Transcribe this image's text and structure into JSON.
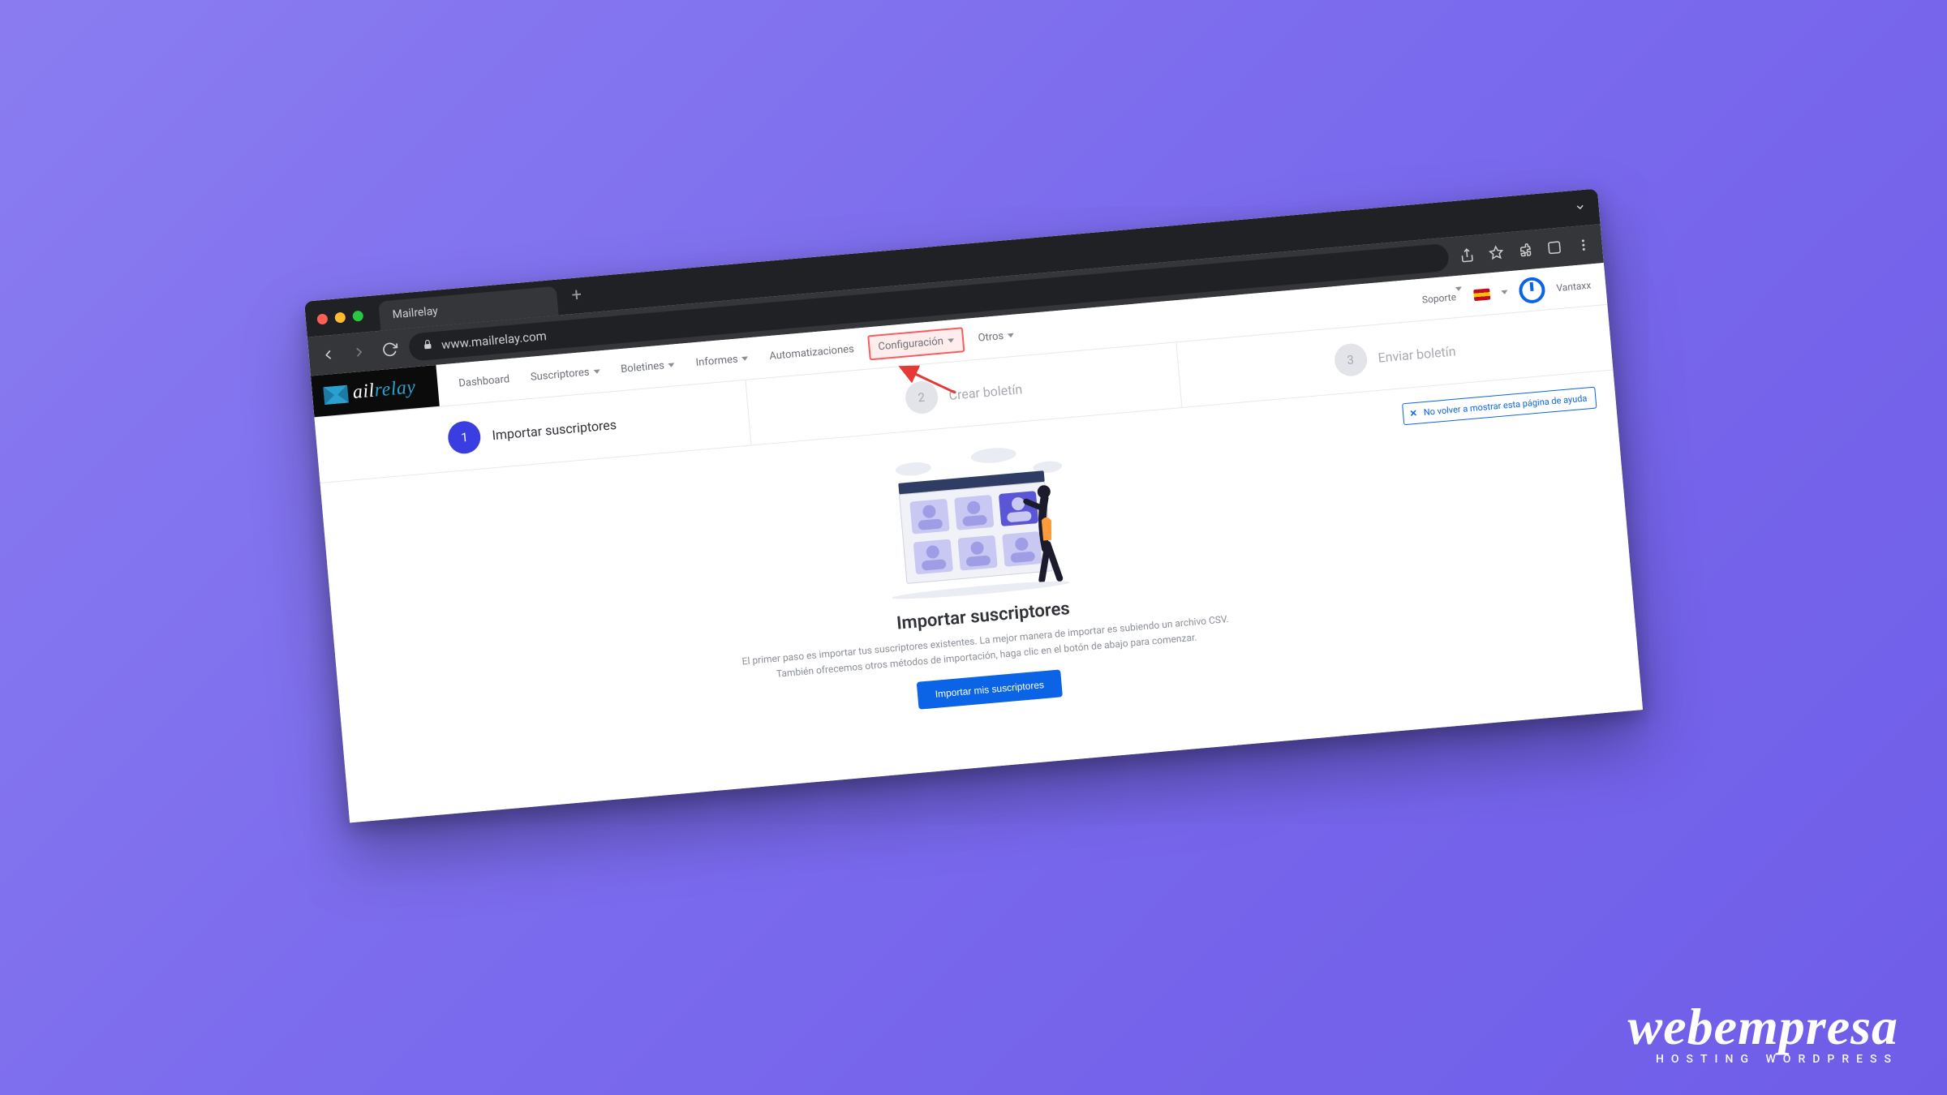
{
  "browser": {
    "tab_title": "Mailrelay",
    "url": "www.mailrelay.com"
  },
  "logo": {
    "prefix": "ail",
    "suffix": "relay"
  },
  "nav": {
    "items": [
      {
        "label": "Dashboard",
        "has_caret": false,
        "highlight": false
      },
      {
        "label": "Suscriptores",
        "has_caret": true,
        "highlight": false
      },
      {
        "label": "Boletines",
        "has_caret": true,
        "highlight": false
      },
      {
        "label": "Informes",
        "has_caret": true,
        "highlight": false
      },
      {
        "label": "Automatizaciones",
        "has_caret": false,
        "highlight": false
      },
      {
        "label": "Configuración",
        "has_caret": true,
        "highlight": true
      },
      {
        "label": "Otros",
        "has_caret": true,
        "highlight": false
      }
    ],
    "right": {
      "support": "Soporte",
      "username": "Vantaxx"
    }
  },
  "steps": [
    {
      "num": "1",
      "label": "Importar suscriptores",
      "active": true
    },
    {
      "num": "2",
      "label": "Crear boletín",
      "active": false
    },
    {
      "num": "3",
      "label": "Enviar boletín",
      "active": false
    }
  ],
  "help_banner": "No volver a mostrar esta página de ayuda",
  "content": {
    "heading": "Importar suscriptores",
    "description": "El primer paso es importar tus suscriptores existentes. La mejor manera de importar es subiendo un archivo CSV. También ofrecemos otros métodos de importación, haga clic en el botón de abajo para comenzar.",
    "cta": "Importar mis suscriptores"
  },
  "watermark": {
    "brand": "webempresa",
    "tagline": "HOSTING WORDPRESS"
  }
}
